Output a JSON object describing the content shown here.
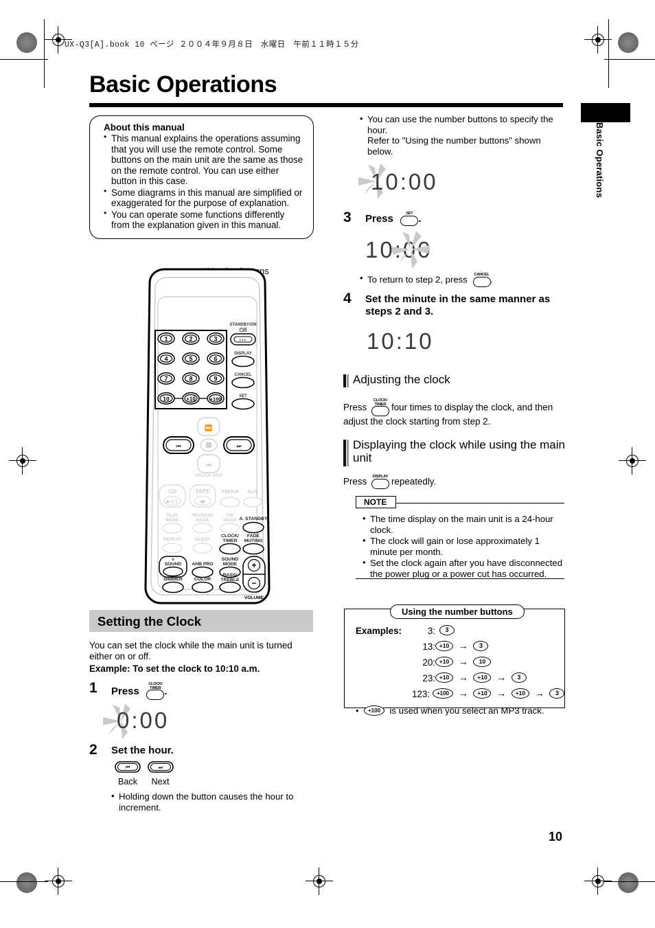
{
  "file_header": "UX-Q3[A].book  10 ページ  ２００４年９月８日　水曜日　午前１１時１５分",
  "page_title": "Basic Operations",
  "side_tab": "Basic Operations",
  "page_number": "10",
  "about_box": {
    "title": "About this manual",
    "bullets": [
      "This manual explains the operations assuming that you will use the remote control. Some buttons on the main unit are the same as those on the remote control.  You can use either button in this case.",
      "Some diagrams in this manual are simplified or exaggerated for the purpose of explanation.",
      "You can operate some functions differently from the explanation given in this manual."
    ]
  },
  "remote": {
    "callout_label": "Number buttons",
    "number_keys": [
      "1",
      "2",
      "3",
      "4",
      "5",
      "6",
      "7",
      "8",
      "9",
      "10",
      "+10",
      "+100"
    ],
    "side_keys": [
      {
        "label": "STANDBY/ON",
        "sub": "⏻/I"
      },
      {
        "label": "DISPLAY",
        "sub": ""
      },
      {
        "label": "CANCEL",
        "sub": ""
      },
      {
        "label": "SET",
        "sub": ""
      }
    ],
    "transport": {
      "prev": "◀◀",
      "stop": "■",
      "next": "▶▶",
      "group_skip": "GROUP SKIP"
    },
    "source_keys": [
      "CD",
      "TAPE",
      "FM/AM",
      "AUX"
    ],
    "mode_keys": [
      "PLAY MODE",
      "REVERSE MODE",
      "FM MODE",
      "A. STANDBY"
    ],
    "func_keys": [
      "REPEAT",
      "SLEEP",
      "CLOCK/ TIMER",
      "FADE MUTING"
    ],
    "sound_keys": [
      "SOUND",
      "AHB PRO",
      "SOUND MODE"
    ],
    "bottom_keys": [
      "DIMMER",
      "COLOR",
      "BASS/ TREBLE"
    ],
    "volume_label": "VOLUME",
    "volume_plus": "+",
    "volume_minus": "−"
  },
  "setting_clock": {
    "heading": "Setting the Clock",
    "intro": "You can set the clock while the main unit is turned either on or off.",
    "example": "Example: To set the clock to 10:10 a.m.",
    "step1": {
      "number": "1",
      "text": "Press",
      "button": "CLOCK/ TIMER",
      "suffix": ".",
      "display": "0:00"
    },
    "step2": {
      "number": "2",
      "text": "Set the hour.",
      "back_label": "Back",
      "next_label": "Next",
      "back_glyph": "◀◀",
      "next_glyph": "▶▶",
      "note": "Holding down the button causes the hour to increment."
    }
  },
  "right_column": {
    "number_note": "You can use the number buttons to specify the hour.\nRefer to \"Using the number buttons\" shown below.",
    "display_hour": "10:00",
    "step3": {
      "number": "3",
      "text": "Press",
      "button": "SET",
      "suffix": ".",
      "display": "10:00",
      "note": "To return to step 2, press",
      "note_button": "CANCEL",
      "note_suffix": "."
    },
    "step4": {
      "number": "4",
      "text": "Set the minute in the same manner as steps 2 and 3.",
      "display": "10:10"
    },
    "adjusting": {
      "heading": "Adjusting the clock",
      "text_before": "Press",
      "button": "CLOCK/ TIMER",
      "text_after": "four times to display the clock, and then adjust the clock starting from step 2."
    },
    "displaying": {
      "heading": "Displaying the clock while using the main unit",
      "text_before": "Press",
      "button": "DISPLAY",
      "text_after": "repeatedly."
    },
    "note": {
      "tag": "NOTE",
      "items": [
        "The time display on the main unit is a 24-hour clock.",
        "The clock will gain or lose approximately 1 minute per month.",
        "Set the clock again after you have disconnected the power plug or a power cut has occurred."
      ]
    },
    "number_buttons_box": {
      "tag": "Using the number buttons",
      "examples_label": "Examples",
      "colon": ":",
      "rows": [
        {
          "value": "3:",
          "keys": [
            "3"
          ]
        },
        {
          "value": "13:",
          "keys": [
            "+10",
            "3"
          ]
        },
        {
          "value": "20:",
          "keys": [
            "+10",
            "10"
          ]
        },
        {
          "value": "23:",
          "keys": [
            "+10",
            "+10",
            "3"
          ]
        },
        {
          "value": "123:",
          "keys": [
            "+100",
            "+10",
            "+10",
            "3"
          ]
        }
      ],
      "footnote_key": "+100",
      "footnote_text": "is used when you select an MP3 track."
    }
  },
  "colors": {
    "heading_bar": "#c9c9c9",
    "ink": "#000000",
    "lcd": "#3a3a3a",
    "burst": "#c8c8c8"
  }
}
